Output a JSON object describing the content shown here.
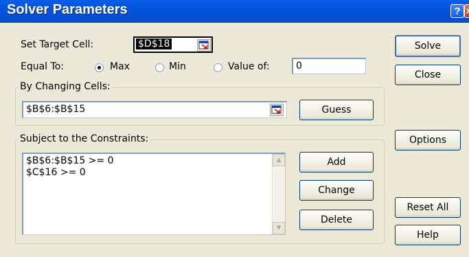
{
  "window": {
    "title": "Solver Parameters",
    "help_glyph": "?",
    "close_glyph": "×"
  },
  "target": {
    "label": "Set Target Cell:",
    "value": "$D$18"
  },
  "equal_to": {
    "label": "Equal To:",
    "options": [
      "Max",
      "Min",
      "Value of:"
    ],
    "selected": "Max",
    "value_of": "0"
  },
  "changing": {
    "group_label": "By Changing Cells:",
    "value": "$B$6:$B$15",
    "guess_label": "Guess"
  },
  "constraints": {
    "group_label": "Subject to the Constraints:",
    "items": [
      "$B$6:$B$15 >= 0",
      "$C$16 >= 0"
    ],
    "add_label": "Add",
    "change_label": "Change",
    "delete_label": "Delete"
  },
  "buttons": {
    "solve": "Solve",
    "close": "Close",
    "options": "Options",
    "reset_all": "Reset All",
    "help": "Help"
  },
  "icons": [
    "help-icon",
    "close-icon",
    "collapse-dialog-icon",
    "scroll-up-icon",
    "scroll-down-icon"
  ]
}
